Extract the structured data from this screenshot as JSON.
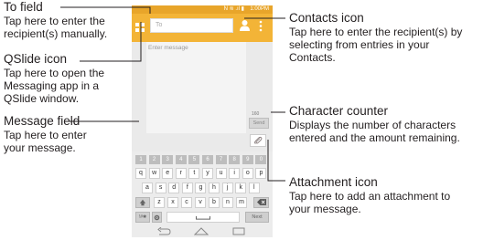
{
  "callouts": {
    "to_field": {
      "title": "To field",
      "lines": [
        "Tap here to enter the",
        "recipient(s) manually."
      ]
    },
    "qslide": {
      "title": "QSlide icon",
      "lines": [
        "Tap here to open the",
        "Messaging app in a",
        "QSlide window."
      ]
    },
    "message_field": {
      "title": "Message field",
      "lines": [
        "Tap here to enter",
        "your message."
      ]
    },
    "contacts": {
      "title": "Contacts icon",
      "lines": [
        "Tap here to enter the recipient(s) by",
        "selecting from entries in your",
        "Contacts."
      ]
    },
    "counter": {
      "title": "Character counter",
      "lines": [
        "Displays the number of characters",
        "entered and the amount remaining."
      ]
    },
    "attachment": {
      "title": "Attachment icon",
      "lines": [
        "Tap here to add an attachment to",
        "your message."
      ]
    }
  },
  "phone": {
    "status_time": "1:00PM",
    "status_icons": "N ≋ .ıl ▮",
    "to_placeholder": "To",
    "message_placeholder": "Enter message",
    "counter_value": "160",
    "send_label": "Send",
    "keyboard": {
      "numbers": [
        "1",
        "2",
        "3",
        "4",
        "5",
        "6",
        "7",
        "8",
        "9",
        "0"
      ],
      "row1": [
        "q",
        "w",
        "e",
        "r",
        "t",
        "y",
        "u",
        "i",
        "o",
        "p"
      ],
      "row2": [
        "a",
        "s",
        "d",
        "f",
        "g",
        "h",
        "j",
        "k",
        "l"
      ],
      "row3": [
        "z",
        "x",
        "c",
        "v",
        "b",
        "n",
        "m"
      ],
      "sym_label": "!#✱",
      "next_label": "Next"
    }
  },
  "colors": {
    "accent": "#f3b437",
    "status": "#e8a52a",
    "leader": "#231f20"
  },
  "icons": [
    "grid-icon",
    "contact-icon",
    "menu-dots-icon",
    "paperclip-icon",
    "shift-icon",
    "backspace-icon",
    "gear-icon",
    "back-icon",
    "home-icon",
    "recent-apps-icon"
  ]
}
